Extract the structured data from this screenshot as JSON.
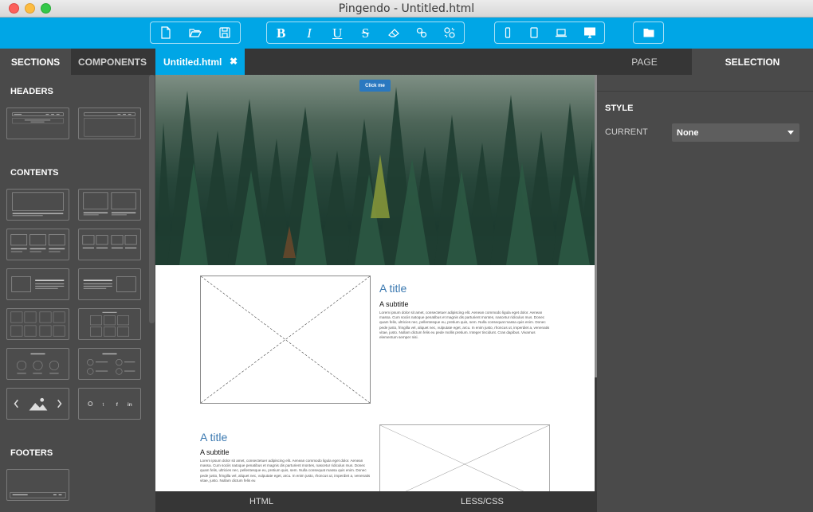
{
  "window": {
    "title": "Pingendo - Untitled.html"
  },
  "toolbar": {
    "file_group": [
      "new-file-icon",
      "open-folder-icon",
      "save-icon"
    ],
    "format_group": {
      "bold": "B",
      "italic": "I",
      "underline": "U",
      "strikethrough": "S",
      "icons": [
        "bold-icon",
        "italic-icon",
        "underline-icon",
        "strikethrough-icon",
        "eraser-icon",
        "link-icon",
        "unlink-icon"
      ]
    },
    "device_group": [
      "phone-icon",
      "tablet-icon",
      "laptop-icon",
      "desktop-icon"
    ],
    "project_group": [
      "folder-icon"
    ],
    "accent": "#00a6e6"
  },
  "left_panel": {
    "tabs": [
      {
        "label": "SECTIONS",
        "active": true
      },
      {
        "label": "COMPONENTS",
        "active": false
      }
    ],
    "headings": {
      "headers": "HEADERS",
      "contents": "CONTENTS",
      "footers": "FOOTERS"
    },
    "gallery_icons": [
      "chevron-left-icon",
      "image-icon",
      "chevron-right-icon"
    ],
    "social_icons": [
      "github-icon",
      "twitter-icon",
      "facebook-icon",
      "linkedin-icon"
    ],
    "social_labels": {
      "twitter": "t",
      "facebook": "f",
      "linkedin": "in"
    }
  },
  "editor": {
    "tab_label": "Untitled.html",
    "tab_close": "✖",
    "hero_button": "Click me",
    "section1": {
      "title": "A title",
      "subtitle": "A subtitle",
      "body": "Lorem ipsum dolor sit amet, consectetuer adipiscing elit. Aenean commodo ligula eget dolor. Aenean massa. Cum sociis natoque penatibus et magnis dis parturient montes, nascetur ridiculus mus. Donec quam felis, ultricies nec, pellentesque eu, pretium quis, sem. Nulla consequat massa quis enim. Donec pede justo, fringilla vel, aliquet nec, vulputate eget, arcu. In enim justo, rhoncus ut, imperdiet a, venenatis vitae, justo. Nullam dictum felis eu pede mollis pretium. Integer tincidunt. Cras dapibus. Vivamus elementum semper nisi."
    },
    "section2": {
      "title": "A title",
      "subtitle": "A subtitle",
      "body": "Lorem ipsum dolor sit amet, consectetuer adipiscing elit. Aenean commodo ligula eget dolor. Aenean massa. Cum sociis natoque penatibus et magnis dis parturient montes, nascetur ridiculus mus. Donec quam felis, ultricies nec, pellentesque eu, pretium quis, sem. Nulla consequat massa quis enim. Donec pede justo, fringilla vel, aliquet nec, vulputate eget, arcu. In enim justo, rhoncus ut, imperdiet a, venenatis vitae, justo. Nullam dictum felis eu"
    }
  },
  "right_panel": {
    "tabs": [
      {
        "label": "PAGE",
        "active": false
      },
      {
        "label": "SELECTION",
        "active": true
      }
    ],
    "style_label": "STYLE",
    "current_label": "CURRENT",
    "current_value": "None"
  },
  "bottom_tabs": {
    "html": "HTML",
    "css": "LESS/CSS"
  }
}
